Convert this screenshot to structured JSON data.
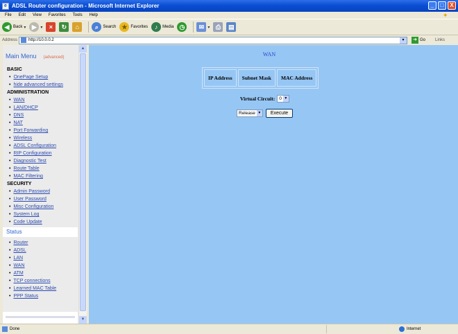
{
  "window": {
    "title": "ADSL Router configuration - Microsoft Internet Explorer",
    "controls": [
      "_",
      "□",
      "X"
    ]
  },
  "menubar": [
    "File",
    "Edit",
    "View",
    "Favorites",
    "Tools",
    "Help"
  ],
  "toolbar": {
    "back": "Back",
    "search": "Search",
    "favorites": "Favorites",
    "media": "Media"
  },
  "addressbar": {
    "label": "Address",
    "url": "http://10.0.0.2",
    "go": "Go",
    "links": "Links"
  },
  "left_menu": {
    "title": "Main Menu",
    "title_note": "(advanced)",
    "sections": [
      {
        "name": "BASIC",
        "items": [
          "OnePage Setup",
          "hide advanced settings"
        ]
      },
      {
        "name": "ADMINISTRATION",
        "items": [
          "WAN",
          "LAN/DHCP",
          "DNS",
          "NAT",
          "Port Forwarding",
          "Wireless",
          "ADSL Configuration",
          "RIP Configuration",
          "Diagnostic Test",
          "Route Table",
          "MAC Filtering"
        ]
      },
      {
        "name": "SECURITY",
        "items": [
          "Admin Password",
          "User Password",
          "Misc Configuration",
          "System Log",
          "Code Update"
        ]
      }
    ],
    "status_header": "Status",
    "status_items": [
      "Router",
      "ADSL",
      "LAN",
      "WAN",
      "ATM",
      "TCP connections",
      "Learned MAC Table",
      "PPP Status"
    ]
  },
  "main": {
    "title": "WAN",
    "table_headers": [
      "IP Address",
      "Subnet Mask",
      "MAC Address"
    ],
    "virtual_circuit_label": "Virtual Circuit:",
    "virtual_circuit_value": "0",
    "action_value": "Release",
    "execute_label": "Execute"
  },
  "statusbar": {
    "text": "Done",
    "zone": "Internet"
  }
}
